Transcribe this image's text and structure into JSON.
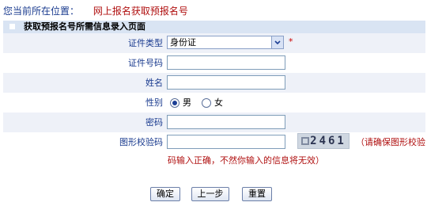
{
  "breadcrumb": {
    "label": "您当前所在位置：",
    "current": "网上报名获取预报名号"
  },
  "section": {
    "title": "获取预报名号所需信息录入页面"
  },
  "form": {
    "id_type": {
      "label": "证件类型",
      "value": "身份证",
      "required_mark": "*"
    },
    "id_number": {
      "label": "证件号码",
      "value": ""
    },
    "name": {
      "label": "姓名",
      "value": ""
    },
    "gender": {
      "label": "性别",
      "options": [
        {
          "label": "男",
          "selected": true
        },
        {
          "label": "女",
          "selected": false
        }
      ]
    },
    "password": {
      "label": "密码",
      "value": ""
    },
    "captcha": {
      "label": "图形校验码",
      "value": "",
      "image_text": "2461",
      "note_line1": "（请确保图形校验",
      "note_line2": "码输入正确，不然你输入的信息将无效）"
    }
  },
  "buttons": {
    "confirm": "确定",
    "prev": "上一步",
    "reset": "重置"
  },
  "colors": {
    "label_blue": "#1a3b8f",
    "warning_red": "#b01010",
    "section_bg": "#d9e4f3",
    "alt_row_bg": "#eef1f8"
  }
}
